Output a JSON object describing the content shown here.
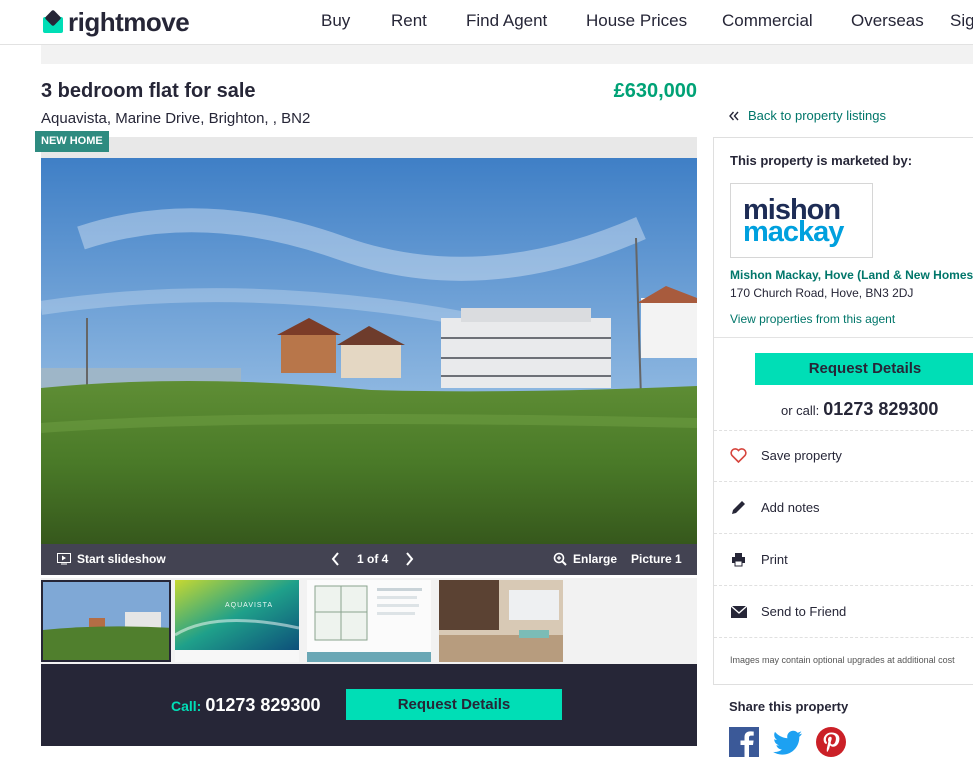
{
  "header": {
    "logo_text": "rightmove",
    "nav": [
      "Buy",
      "Rent",
      "Find Agent",
      "House Prices",
      "Commercial",
      "Overseas",
      "Sig"
    ]
  },
  "listing": {
    "title": "3 bedroom flat for sale",
    "address": "Aquavista, Marine Drive, Brighton, , BN2",
    "price": "£630,000",
    "badge": "NEW HOME"
  },
  "gallery": {
    "slideshow_label": "Start slideshow",
    "counter": "1 of 4",
    "enlarge_label": "Enlarge",
    "picture_label": "Picture 1",
    "thumb_brand_text": "AQUAVISTA"
  },
  "cta": {
    "call_label": "Call:",
    "phone": "01273 829300",
    "request_label": "Request Details"
  },
  "sidebar": {
    "back_label": "Back to property listings",
    "marketed_by": "This property is marketed by:",
    "agent_logo": [
      "mishon",
      "mackay"
    ],
    "agent_name": "Mishon Mackay, Hove (Land & New Homes)",
    "agent_address": "170 Church Road, Hove, BN3 2DJ",
    "agent_link": "View properties from this agent",
    "request_label": "Request Details",
    "or_call_label": "or call:",
    "phone": "01273 829300",
    "actions": [
      "Save property",
      "Add notes",
      "Print",
      "Send to Friend"
    ],
    "disclaimer": "Images may contain optional upgrades at additional cost",
    "share_title": "Share this property"
  },
  "colors": {
    "brand_navy": "#262637",
    "accent_teal": "#00deb6",
    "price_green": "#00a276",
    "link_green": "#00766a",
    "badge": "#2e8b80"
  },
  "icons": [
    "slideshow-icon",
    "chevron-left-icon",
    "chevron-right-icon",
    "zoom-icon",
    "double-chevron-left-icon",
    "heart-icon",
    "pencil-icon",
    "printer-icon",
    "envelope-icon",
    "facebook-icon",
    "twitter-icon",
    "pinterest-icon"
  ]
}
